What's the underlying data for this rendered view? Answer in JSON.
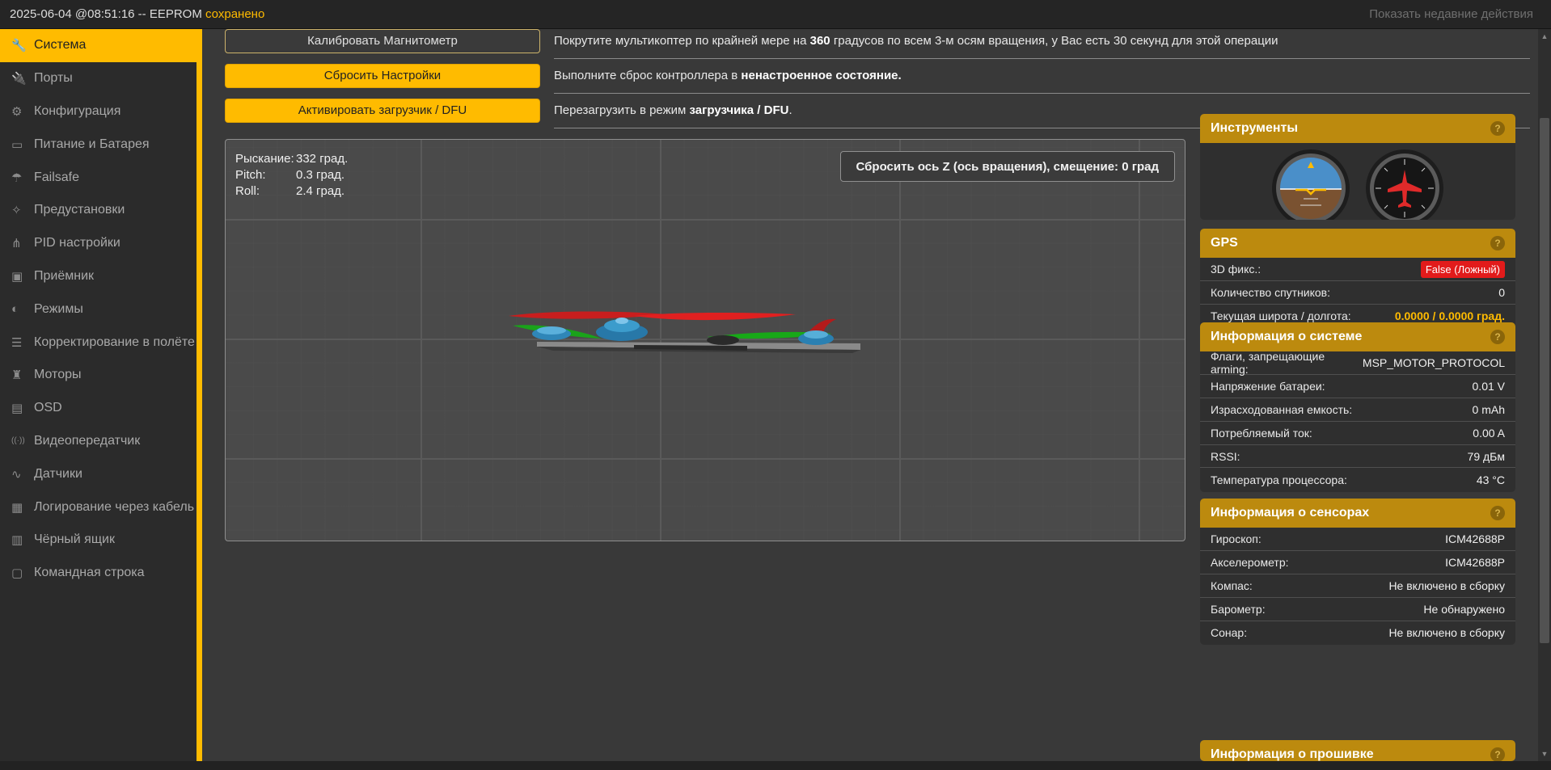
{
  "topbar": {
    "log_prefix": "2025-06-04 @08:51:16 -- EEPROM ",
    "log_status": "сохранено",
    "recent_actions": "Показать недавние действия"
  },
  "sidebar": {
    "items": [
      {
        "label": "Система",
        "icon": "wrench-icon"
      },
      {
        "label": "Порты",
        "icon": "plug-icon"
      },
      {
        "label": "Конфигурация",
        "icon": "gear-icon"
      },
      {
        "label": "Питание и Батарея",
        "icon": "battery-icon"
      },
      {
        "label": "Failsafe",
        "icon": "parachute-icon"
      },
      {
        "label": "Предустановки",
        "icon": "magic-wand-icon"
      },
      {
        "label": "PID настройки",
        "icon": "network-icon"
      },
      {
        "label": "Приёмник",
        "icon": "receiver-icon"
      },
      {
        "label": "Режимы",
        "icon": "toggle-icon"
      },
      {
        "label": "Корректирование в полёте",
        "icon": "sliders-icon"
      },
      {
        "label": "Моторы",
        "icon": "motor-icon"
      },
      {
        "label": "OSD",
        "icon": "osd-icon"
      },
      {
        "label": "Видеопередатчик",
        "icon": "broadcast-icon"
      },
      {
        "label": "Датчики",
        "icon": "pulse-icon"
      },
      {
        "label": "Логирование через кабель",
        "icon": "cable-icon"
      },
      {
        "label": "Чёрный ящик",
        "icon": "blackbox-icon"
      },
      {
        "label": "Командная строка",
        "icon": "terminal-icon"
      }
    ]
  },
  "actions": {
    "calibrate_mag": {
      "label": "Калибровать Магнитометр",
      "desc_pre": "Покрутите мультикоптер по крайней мере на ",
      "desc_bold": "360",
      "desc_post": " градусов по всем 3-м осям вращения, у Вас есть 30 секунд для этой операции"
    },
    "reset_settings": {
      "label": "Сбросить Настройки",
      "desc_pre": "Выполните сброс контроллера в ",
      "desc_bold": "ненастроенное состояние.",
      "desc_post": ""
    },
    "activate_dfu": {
      "label": "Активировать загрузчик / DFU",
      "desc_pre": "Перезагрузить в режим ",
      "desc_bold": "загрузчика / DFU",
      "desc_post": "."
    }
  },
  "model": {
    "yaw_label": "Рыскание:",
    "yaw_value": "332 град.",
    "pitch_label": "Pitch:",
    "pitch_value": "0.3 град.",
    "roll_label": "Roll:",
    "roll_value": "2.4 град.",
    "reset_z_button": "Сбросить ось Z (ось вращения), смещение: 0 град"
  },
  "panels": {
    "instruments": {
      "title": "Инструменты",
      "help": "?"
    },
    "gps": {
      "title": "GPS",
      "help": "?",
      "rows": [
        {
          "label": "3D фикс.:",
          "value": "False (Ложный)"
        },
        {
          "label": "Количество спутников:",
          "value": "0"
        },
        {
          "label": "Текущая широта / долгота:",
          "value": "0.0000 / 0.0000 град."
        }
      ]
    },
    "system": {
      "title": "Информация о системе",
      "help": "?",
      "rows": [
        {
          "label": "Флаги, запрещающие arming:",
          "value": "MSP_MOTOR_PROTOCOL"
        },
        {
          "label": "Напряжение батареи:",
          "value": "0.01 V"
        },
        {
          "label": "Израсходованная емкость:",
          "value": "0 mAh"
        },
        {
          "label": "Потребляемый ток:",
          "value": "0.00 A"
        },
        {
          "label": "RSSI:",
          "value": "79 дБм"
        },
        {
          "label": "Температура процессора:",
          "value": "43 °C"
        }
      ]
    },
    "sensors": {
      "title": "Информация о сенсорах",
      "help": "?",
      "rows": [
        {
          "label": "Гироскоп:",
          "value": "ICM42688P"
        },
        {
          "label": "Акселерометр:",
          "value": "ICM42688P"
        },
        {
          "label": "Компас:",
          "value": "Не включено в сборку"
        },
        {
          "label": "Барометр:",
          "value": "Не обнаружено"
        },
        {
          "label": "Сонар:",
          "value": "Не включено в сборку"
        }
      ]
    },
    "firmware": {
      "title": "Информация о прошивке",
      "help": "?"
    }
  },
  "colors": {
    "accent": "#ffbb00",
    "panel_header": "#bc8a0e",
    "error_badge": "#e21b1b"
  }
}
